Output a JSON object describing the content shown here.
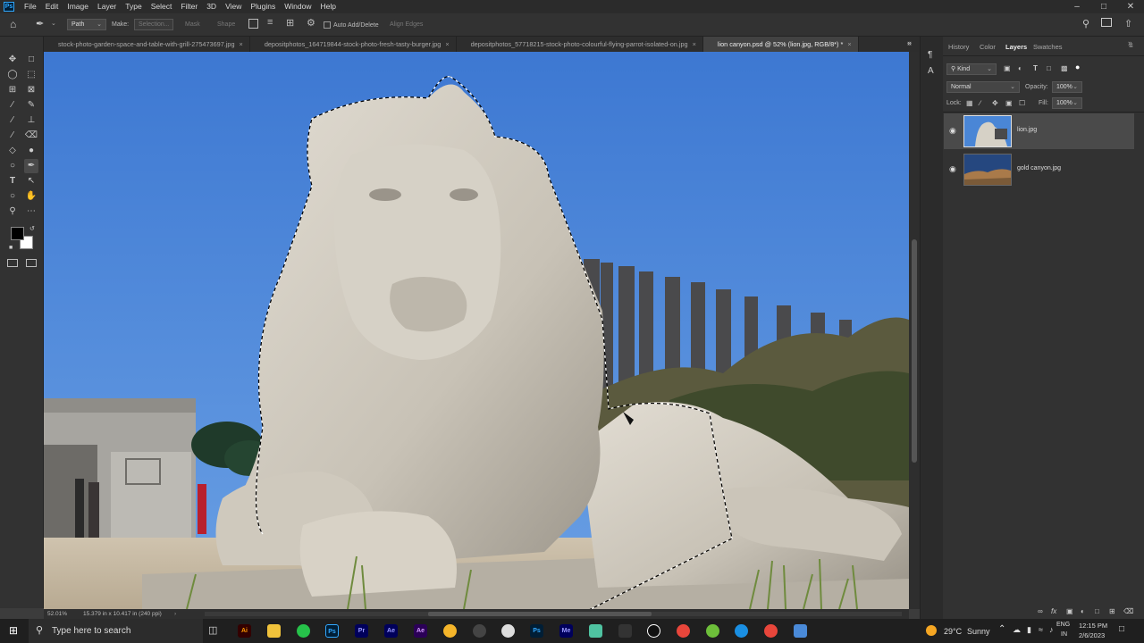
{
  "menu": {
    "logo": "Ps",
    "items": [
      "File",
      "Edit",
      "Image",
      "Layer",
      "Type",
      "Select",
      "Filter",
      "3D",
      "View",
      "Plugins",
      "Window",
      "Help"
    ]
  },
  "options_bar": {
    "mode": "Path",
    "make_label": "Make:",
    "selection": "Selection...",
    "mask": "Mask",
    "shape": "Shape",
    "auto_add_delete": "Auto Add/Delete",
    "align_edges": "Align Edges"
  },
  "tabs": [
    {
      "label": "stock-photo-garden-space-and-table-with-grill-275473697.jpg",
      "active": false
    },
    {
      "label": "depositphotos_164719844-stock-photo-fresh-tasty-burger.jpg",
      "active": false
    },
    {
      "label": "depositphotos_57718215-stock-photo-colourful-flying-parrot-isolated-on.jpg",
      "active": false
    },
    {
      "label": "lion canyon.psd @ 52% (lion.jpg, RGB/8*) *",
      "active": true
    }
  ],
  "status": {
    "zoom": "52.01%",
    "doc_size": "15.379 in x 10.417 in (240 ppi)"
  },
  "panel": {
    "tabs": [
      "History",
      "Color",
      "Layers",
      "Swatches"
    ],
    "active_tab": "Layers",
    "kind_label": "Kind",
    "blend_mode": "Normal",
    "opacity_label": "Opacity:",
    "opacity_value": "100%",
    "lock_label": "Lock:",
    "fill_label": "Fill:",
    "fill_value": "100%",
    "layers": [
      {
        "name": "lion.jpg",
        "visible": true,
        "selected": true
      },
      {
        "name": "gold canyon.jpg",
        "visible": true,
        "selected": false
      }
    ]
  },
  "taskbar": {
    "search_placeholder": "Type here to search",
    "apps": [
      "Ai",
      "Ps",
      "Pr",
      "Ae",
      "Ae",
      "Ps",
      "Me"
    ],
    "weather_temp": "29°C",
    "weather_cond": "Sunny",
    "lang": "ENG",
    "region": "IN",
    "time": "12:15 PM",
    "date": "2/6/2023"
  }
}
